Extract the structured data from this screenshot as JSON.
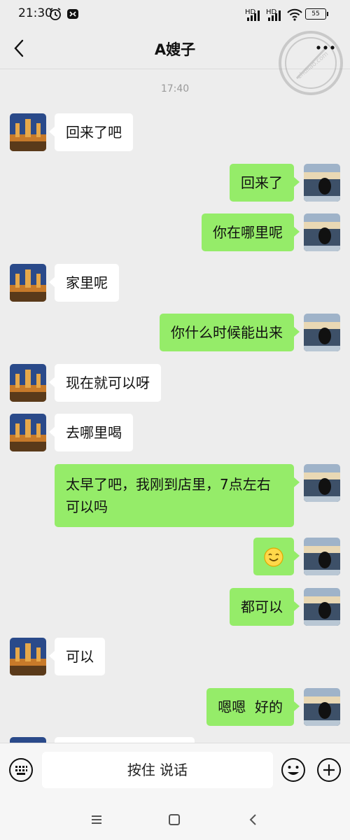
{
  "status_bar": {
    "time": "21:30",
    "signal1": "HD",
    "signal2": "HD",
    "battery": "55"
  },
  "header": {
    "title": "A嫂子",
    "watermark_text": "zhuilao.com"
  },
  "chat": {
    "timestamp": "17:40",
    "messages": [
      {
        "side": "left",
        "text": "回来了吧"
      },
      {
        "side": "right",
        "text": "回来了"
      },
      {
        "side": "right",
        "text": "你在哪里呢"
      },
      {
        "side": "left",
        "text": "家里呢"
      },
      {
        "side": "right",
        "text": "你什么时候能出来"
      },
      {
        "side": "left",
        "text": "现在就可以呀"
      },
      {
        "side": "left",
        "text": "去哪里喝"
      },
      {
        "side": "right",
        "text": "太早了吧，我刚到店里，7点左右可以吗"
      },
      {
        "side": "right",
        "emoji": "smile-emoji"
      },
      {
        "side": "right",
        "text": "都可以"
      },
      {
        "side": "left",
        "text": "可以"
      },
      {
        "side": "right",
        "text": "嗯嗯  好的"
      }
    ]
  },
  "input_bar": {
    "voice_label": "按住 说话"
  },
  "colors": {
    "sent_bubble": "#95ec69",
    "received_bubble": "#ffffff",
    "background": "#ededed"
  },
  "icons": [
    "back-icon",
    "more-icon",
    "keyboard-icon",
    "emoji-icon",
    "plus-icon",
    "menu-icon",
    "home-icon",
    "nav-back-icon"
  ]
}
